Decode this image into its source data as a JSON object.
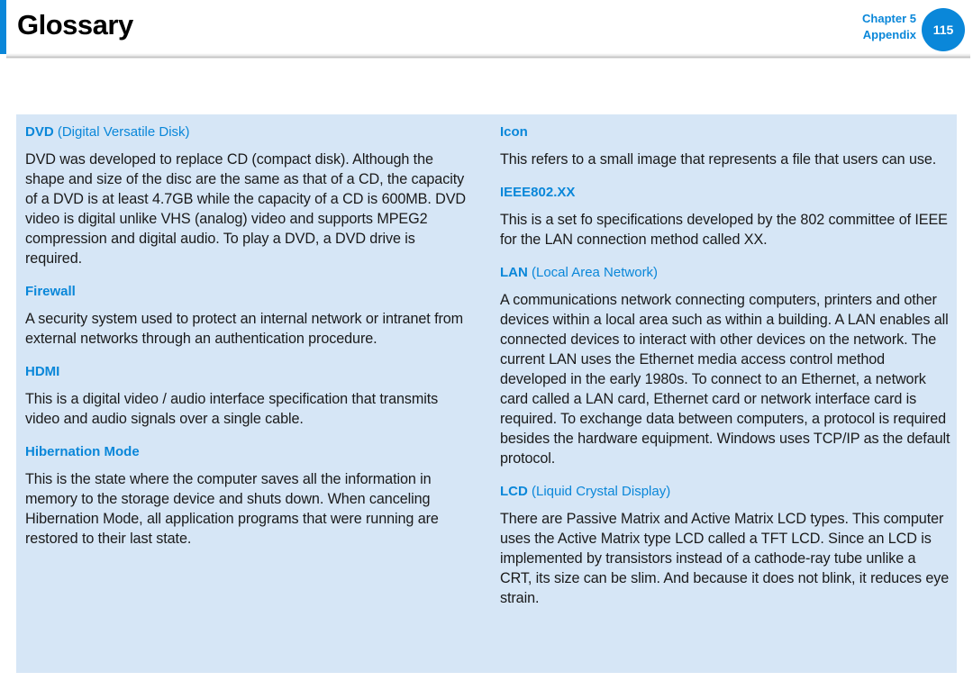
{
  "header": {
    "title": "Glossary",
    "chapter": "Chapter 5",
    "section": "Appendix",
    "page_number": "115",
    "accent_color": "#0a87d9"
  },
  "glossary": {
    "left": [
      {
        "term": "DVD",
        "expansion": "(Digital Versatile Disk)",
        "definition": "DVD was developed to replace CD (compact disk). Although the shape and size of the disc are the same as that of a CD, the capacity of a DVD is at least 4.7GB while the capacity of a CD is 600MB. DVD video is digital unlike VHS (analog) video and supports MPEG2 compression and digital audio. To play a DVD, a DVD drive is required."
      },
      {
        "term": "Firewall",
        "expansion": "",
        "definition": "A security system used to protect an internal network or intranet from external networks through an authentication procedure."
      },
      {
        "term": "HDMI",
        "expansion": "",
        "definition": "This is a digital video / audio interface specification that transmits video and audio signals over a single cable."
      },
      {
        "term": "Hibernation Mode",
        "expansion": "",
        "definition": "This is the state where the computer saves all the information in memory to the storage device and shuts down. When canceling Hibernation Mode, all application programs that were running are restored to their last state."
      }
    ],
    "right": [
      {
        "term": "Icon",
        "expansion": "",
        "definition": "This refers to a small image that represents a file that users can use."
      },
      {
        "term": "IEEE802.XX",
        "expansion": "",
        "definition": "This is a set fo specifications developed by the 802 committee of IEEE for the LAN connection method called XX."
      },
      {
        "term": "LAN",
        "expansion": "(Local Area Network)",
        "definition": "A communications network connecting computers, printers and other devices within a local area such as within a building. A LAN enables all connected devices to interact with other devices on the network. The current LAN uses the Ethernet media access control method developed in the early 1980s. To connect to an Ethernet, a network card called a LAN card, Ethernet card or network interface card is required. To exchange data between computers, a protocol is required besides the hardware equipment. Windows uses TCP/IP as the default protocol."
      },
      {
        "term": "LCD",
        "expansion": "(Liquid Crystal Display)",
        "definition": "There are Passive Matrix and Active Matrix LCD types. This computer uses the Active Matrix type LCD called a TFT LCD. Since an LCD is implemented by transistors instead of a cathode-ray tube unlike a CRT, its size can be slim. And because it does not blink, it reduces eye strain."
      }
    ]
  }
}
